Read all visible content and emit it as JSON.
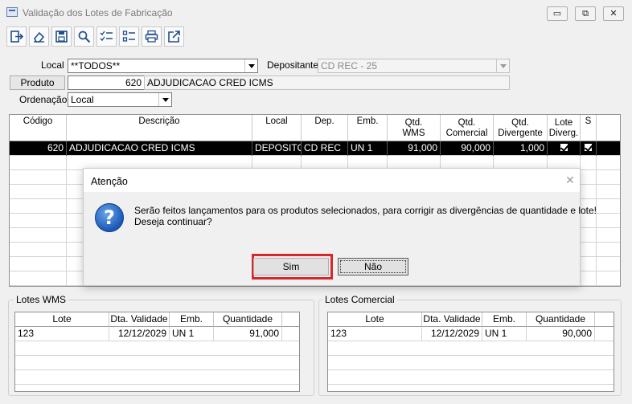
{
  "window": {
    "title": "Validação dos Lotes de Fabricação",
    "controls": {
      "minimize": "▭",
      "restore": "⧉",
      "close": "✕"
    }
  },
  "toolbar": {
    "buttons": [
      "exit-icon",
      "clear-icon",
      "save-icon",
      "search-icon",
      "check-list-icon",
      "list-icon",
      "print-icon",
      "export-icon"
    ]
  },
  "form": {
    "local_label": "Local",
    "local_value": "**TODOS**",
    "depositante_label": "Depositante",
    "depositante_value": "CD REC - 25",
    "produto_label": "Produto",
    "produto_code": "620",
    "produto_desc": "ADJUDICACAO CRED ICMS",
    "ordenacao_label": "Ordenação",
    "ordenacao_value": "Local"
  },
  "grid": {
    "headers": {
      "codigo": "Código",
      "descricao": "Descrição",
      "local": "Local",
      "dep": "Dep.",
      "emb": "Emb.",
      "qtd_wms_1": "Qtd.",
      "qtd_wms_2": "WMS",
      "qtd_com_1": "Qtd.",
      "qtd_com_2": "Comercial",
      "qtd_div_1": "Qtd.",
      "qtd_div_2": "Divergente",
      "lote_1": "Lote",
      "lote_2": "Diverg.",
      "s": "S"
    },
    "row": {
      "codigo": "620",
      "descricao": "ADJUDICACAO CRED ICMS",
      "local": "DEPOSITO",
      "dep": "CD REC",
      "emb": "UN 1",
      "qtd_wms": "91,000",
      "qtd_comercial": "90,000",
      "qtd_divergente": "1,000",
      "lote_diverg": true,
      "s": true
    }
  },
  "lotes_wms": {
    "title": "Lotes WMS",
    "headers": {
      "lote": "Lote",
      "validade": "Dta. Validade",
      "emb": "Emb.",
      "qtd": "Quantidade"
    },
    "row": {
      "lote": "123",
      "validade": "12/12/2029",
      "emb": "UN 1",
      "qtd": "91,000"
    }
  },
  "lotes_comercial": {
    "title": "Lotes Comercial",
    "headers": {
      "lote": "Lote",
      "validade": "Dta. Validade",
      "emb": "Emb.",
      "qtd": "Quantidade"
    },
    "row": {
      "lote": "123",
      "validade": "12/12/2029",
      "emb": "UN 1",
      "qtd": "90,000"
    }
  },
  "dialog": {
    "title": "Atenção",
    "close": "✕",
    "icon": "question-icon",
    "line1": "Serão feitos lançamentos para os produtos selecionados, para corrigir as divergências de quantidade e lote!",
    "line2": "Deseja continuar?",
    "yes": "Sim",
    "no": "Não",
    "highlight_color": "#d9262b"
  }
}
